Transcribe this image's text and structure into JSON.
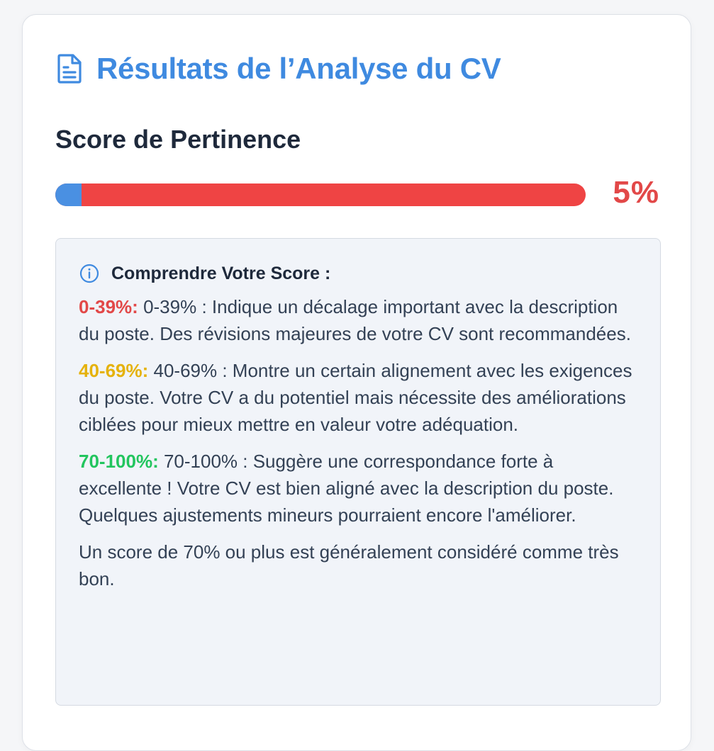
{
  "header": {
    "title": "Résultats de l’Analyse du CV",
    "icon": "document-icon"
  },
  "score": {
    "heading": "Score de Pertinence",
    "value_text": "5%",
    "fraction": 0.05,
    "colors": {
      "fill": "#4a90e2",
      "track": "#ef4444",
      "value": "#e24848"
    }
  },
  "info": {
    "icon": "info-icon",
    "title": "Comprendre Votre Score :",
    "ranges": [
      {
        "label": "0-39%:",
        "text": "0-39% : Indique un décalage important avec la description du poste. Des révisions majeures de votre CV sont recommandées.",
        "color": "#e24848"
      },
      {
        "label": "40-69%:",
        "text": "40-69% : Montre un certain alignement avec les exigences du poste. Votre CV a du potentiel mais nécessite des améliorations ciblées pour mieux mettre en valeur votre adéquation.",
        "color": "#e5b20c"
      },
      {
        "label": "70-100%:",
        "text": "70-100% : Suggère une correspondance forte à excellente ! Votre CV est bien aligné avec la description du poste. Quelques ajustements mineurs pourraient encore l'améliorer.",
        "color": "#22c55e"
      }
    ],
    "note": "Un score de 70% ou plus est généralement considéré comme très bon."
  },
  "colors": {
    "accent": "#3f8ae0",
    "text": "#1e293b",
    "info_bg": "#f1f4f9"
  }
}
